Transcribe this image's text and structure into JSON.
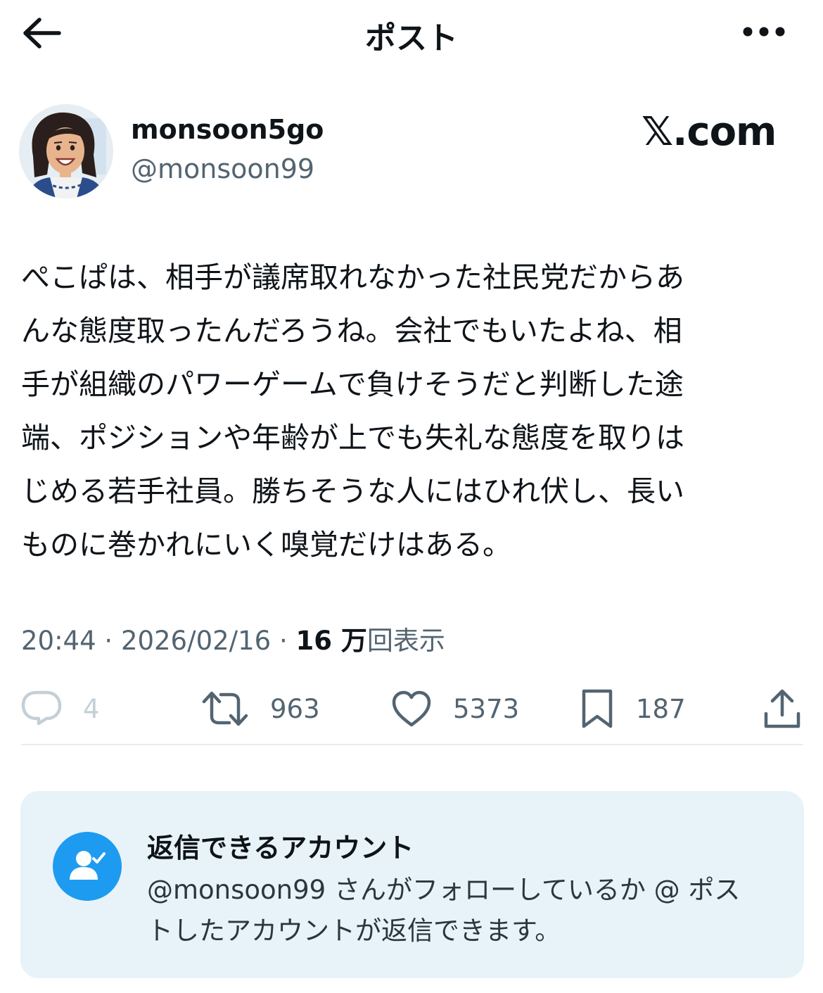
{
  "header": {
    "title": "ポスト",
    "back_icon": "arrow-left-icon",
    "more_icon": "more-horizontal-icon"
  },
  "author": {
    "display_name": "monsoon5go",
    "handle": "@monsoon99",
    "avatar": "avatar-illustration"
  },
  "watermark": "𝕏.com",
  "post": {
    "lines": [
      "ぺこぱは、相手が議席取れなかった社民党だからあ",
      "んな態度取ったんだろうね。会社でもいたよね、相",
      "手が組織のパワーゲームで負けそうだと判断した途",
      "端、ポジションや年齢が上でも失礼な態度を取りは",
      "じめる若手社員。勝ちそうな人にはひれ伏し、長い",
      "ものに巻かれにいく嗅覚だけはある。"
    ]
  },
  "meta": {
    "time": "20:44",
    "separator": " · ",
    "date": "2026/02/16",
    "views_count": "16 万",
    "views_label": "回表示"
  },
  "actions": {
    "reply": {
      "icon": "reply-icon",
      "count": "4"
    },
    "repost": {
      "icon": "repost-icon",
      "count": "963"
    },
    "like": {
      "icon": "heart-icon",
      "count": "5373"
    },
    "bookmark": {
      "icon": "bookmark-icon",
      "count": "187"
    },
    "share": {
      "icon": "share-icon"
    }
  },
  "reply_settings": {
    "icon": "person-check-icon",
    "title": "返信できるアカウント",
    "description_lines": [
      "@monsoon99 さんがフォローしているか @ ポス",
      "トしたアカウントが返信できます。"
    ]
  },
  "colors": {
    "text_primary": "#0f1419",
    "text_secondary": "#536471",
    "accent": "#1d9bf0",
    "card_background": "#e8f3f9"
  }
}
